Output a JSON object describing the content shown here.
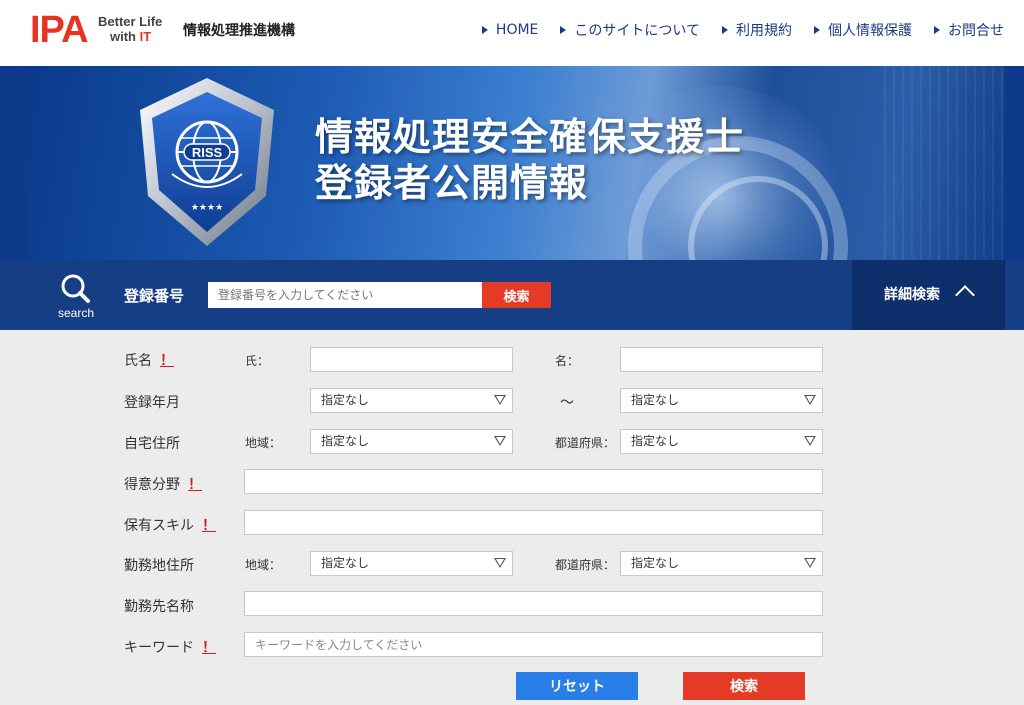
{
  "header": {
    "logo": "IPA",
    "tagline_line1": "Better Life",
    "tagline_with": "with",
    "tagline_it": "IT",
    "org_name": "情報処理推進機構",
    "nav": [
      {
        "label": "HOME"
      },
      {
        "label": "このサイトについて"
      },
      {
        "label": "利用規約"
      },
      {
        "label": "個人情報保護"
      },
      {
        "label": "お問合せ"
      }
    ]
  },
  "banner": {
    "title_line1": "情報処理安全確保支援士",
    "title_line2": "登録者公開情報",
    "badge_text": "RISS"
  },
  "searchbar": {
    "icon_label": "search",
    "reg_label": "登録番号",
    "reg_placeholder": "登録番号を入力してください",
    "reg_button": "検索",
    "advanced_label": "詳細検索"
  },
  "form": {
    "name": {
      "label": "氏名",
      "required_mark": "！",
      "sub1": "氏：",
      "sub2": "名："
    },
    "reg_date": {
      "label": "登録年月",
      "from": "指定なし",
      "tilde": "〜",
      "to": "指定なし"
    },
    "home_address": {
      "label": "自宅住所",
      "sub1": "地域：",
      "region": "指定なし",
      "sub2": "都道府県：",
      "prefecture": "指定なし"
    },
    "specialty": {
      "label": "得意分野",
      "required_mark": "！"
    },
    "skills": {
      "label": "保有スキル",
      "required_mark": "！"
    },
    "work_address": {
      "label": "勤務地住所",
      "sub1": "地域：",
      "region": "指定なし",
      "sub2": "都道府県：",
      "prefecture": "指定なし"
    },
    "employer": {
      "label": "勤務先名称"
    },
    "keyword": {
      "label": "キーワード",
      "required_mark": "！",
      "placeholder": "キーワードを入力してください"
    },
    "reset_button": "リセット",
    "search_button": "検索"
  }
}
